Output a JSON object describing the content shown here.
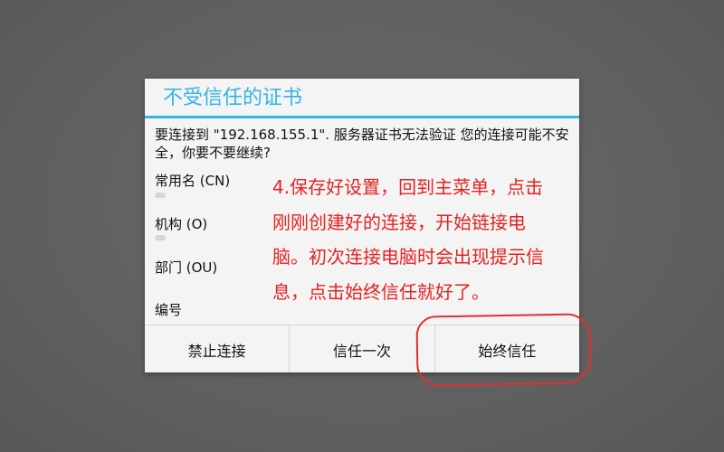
{
  "dialog": {
    "title": "不受信任的证书",
    "message": "要连接到 \"192.168.155.1\". 服务器证书无法验证 您的连接可能不安全，你要不要继续?",
    "fields": [
      {
        "label": "常用名 (CN)"
      },
      {
        "label": "机构 (O)"
      },
      {
        "label": "部门 (OU)"
      },
      {
        "label": "编号"
      }
    ],
    "buttons": {
      "deny": "禁止连接",
      "trust_once": "信任一次",
      "trust_always": "始终信任"
    }
  },
  "annotation": {
    "text": "4.保存好设置，回到主菜单，点击刚刚创建好的连接，开始链接电脑。初次连接电脑时会出现提示信息，点击始终信任就好了。",
    "color": "#e52222"
  },
  "colors": {
    "accent": "#33b5e5",
    "background": "#616161",
    "highlight_circle": "#e03030"
  }
}
